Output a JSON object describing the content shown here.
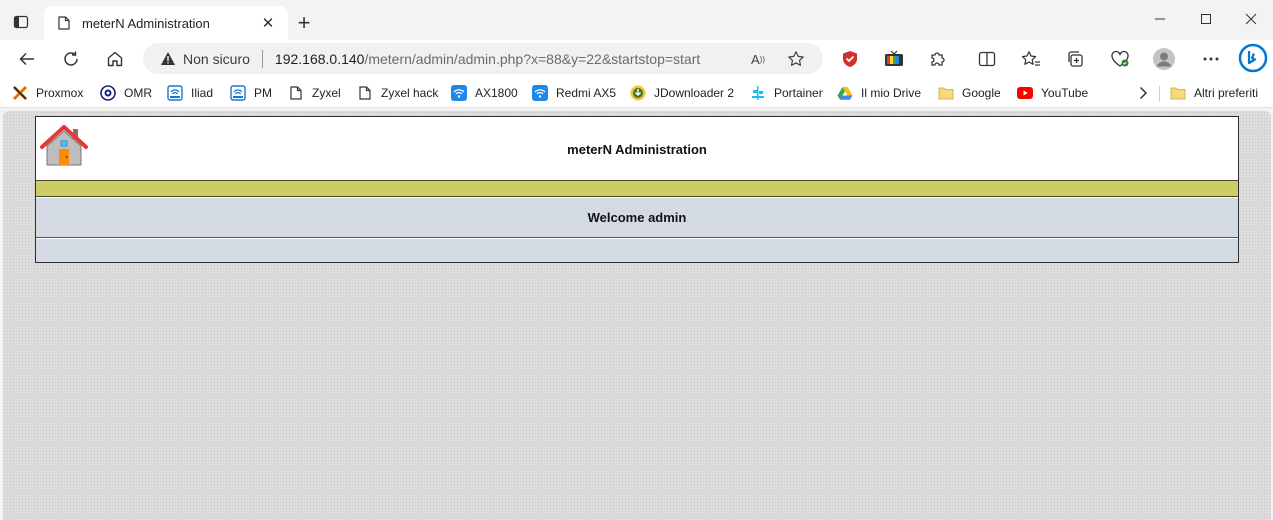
{
  "browser": {
    "tab": {
      "title": "meterN Administration"
    },
    "address": {
      "security_label": "Non sicuro",
      "host": "192.168.0.140",
      "path": "/metern/admin/admin.php?x=88&y=22&startstop=start"
    },
    "bookmarks": [
      {
        "label": "Proxmox",
        "icon": "proxmox-icon"
      },
      {
        "label": "OMR",
        "icon": "omr-icon"
      },
      {
        "label": "Iliad",
        "icon": "router-icon"
      },
      {
        "label": "PM",
        "icon": "router-icon"
      },
      {
        "label": "Zyxel",
        "icon": "page-icon"
      },
      {
        "label": "Zyxel hack",
        "icon": "page-icon"
      },
      {
        "label": "AX1800",
        "icon": "wifi-icon"
      },
      {
        "label": "Redmi AX5",
        "icon": "wifi-icon"
      },
      {
        "label": "JDownloader 2",
        "icon": "jdownloader-icon"
      },
      {
        "label": "Portainer",
        "icon": "portainer-icon"
      },
      {
        "label": "Il mio Drive",
        "icon": "google-drive-icon"
      },
      {
        "label": "Google",
        "icon": "folder-icon"
      },
      {
        "label": "YouTube",
        "icon": "youtube-icon"
      }
    ],
    "other_favorites": "Altri preferiti"
  },
  "page": {
    "title": "meterN Administration",
    "welcome": "Welcome admin"
  },
  "colors": {
    "band": "#cdcd66",
    "welcome_bg": "#d4dae2",
    "edge_accent": "#0078d4"
  }
}
